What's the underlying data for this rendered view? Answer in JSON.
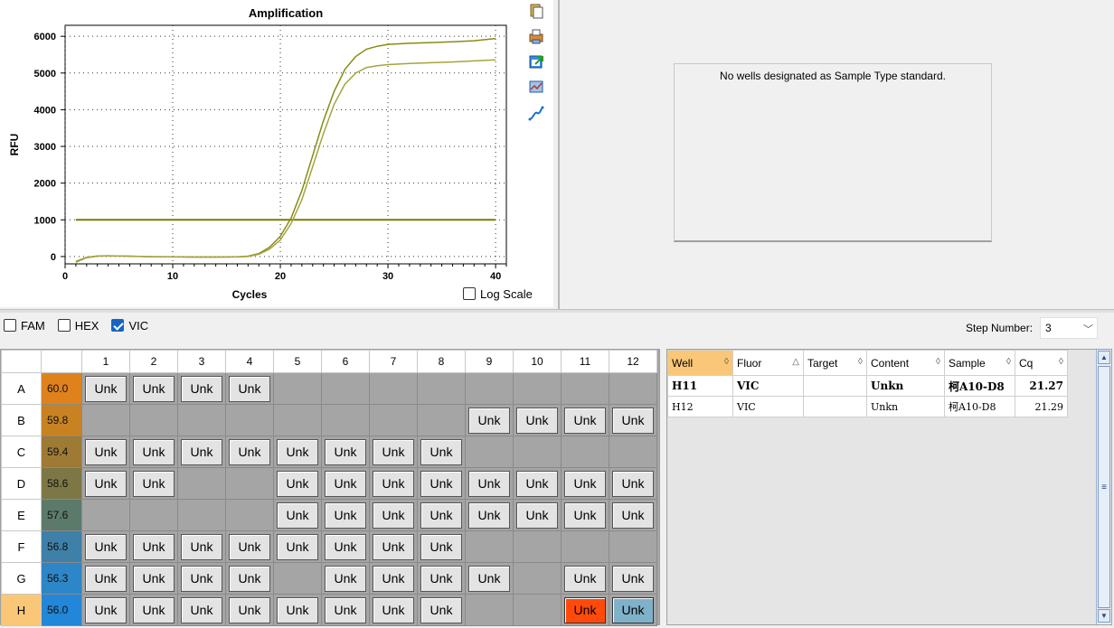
{
  "chart": {
    "title": "Amplification",
    "xlabel": "Cycles",
    "ylabel": "RFU",
    "log_scale_label": "Log Scale",
    "log_scale_checked": false
  },
  "chart_data": {
    "type": "line",
    "title": "Amplification",
    "xlabel": "Cycles",
    "ylabel": "RFU",
    "xlim": [
      0,
      41
    ],
    "ylim": [
      -200,
      6300
    ],
    "x_ticks": [
      0,
      10,
      20,
      30,
      40
    ],
    "y_ticks": [
      0,
      1000,
      2000,
      3000,
      4000,
      5000,
      6000
    ],
    "grid": "dotted",
    "series": [
      {
        "color": "#8a8a14",
        "x": [
          1,
          2,
          3,
          4,
          6,
          8,
          10,
          12,
          14,
          16,
          17,
          18,
          19,
          20,
          21,
          22,
          23,
          24,
          25,
          26,
          27,
          28,
          29,
          30,
          32,
          34,
          36,
          38,
          40
        ],
        "y": [
          -150,
          -30,
          10,
          20,
          10,
          -5,
          -10,
          -15,
          -15,
          -10,
          10,
          80,
          250,
          550,
          1050,
          1800,
          2750,
          3700,
          4500,
          5100,
          5450,
          5650,
          5730,
          5780,
          5810,
          5830,
          5850,
          5880,
          5940
        ]
      },
      {
        "color": "#a4a440",
        "x": [
          1,
          2,
          3,
          4,
          6,
          8,
          10,
          12,
          14,
          16,
          17,
          18,
          19,
          20,
          21,
          22,
          23,
          24,
          25,
          26,
          27,
          28,
          29,
          30,
          32,
          34,
          36,
          38,
          40
        ],
        "y": [
          -130,
          -20,
          15,
          20,
          10,
          -5,
          -10,
          -15,
          -15,
          -10,
          0,
          60,
          200,
          450,
          900,
          1550,
          2450,
          3350,
          4150,
          4700,
          5000,
          5150,
          5200,
          5230,
          5260,
          5280,
          5300,
          5330,
          5360
        ]
      }
    ],
    "threshold": {
      "value": 1000,
      "color": "#7a7a05"
    }
  },
  "standard_curve": {
    "message": "No wells designated as Sample Type standard."
  },
  "fluors": [
    {
      "label": "FAM",
      "checked": false
    },
    {
      "label": "HEX",
      "checked": false
    },
    {
      "label": "VIC",
      "checked": true
    }
  ],
  "step": {
    "label": "Step Number:",
    "value": "3"
  },
  "plate": {
    "columns": [
      "1",
      "2",
      "3",
      "4",
      "5",
      "6",
      "7",
      "8",
      "9",
      "10",
      "11",
      "12"
    ],
    "selected_column": "11",
    "rows": [
      {
        "label": "A",
        "temp": "60.0",
        "temp_color": "#e0821c",
        "wells": [
          "Unk",
          "Unk",
          "Unk",
          "Unk",
          "",
          "",
          "",
          "",
          "",
          "",
          "",
          ""
        ]
      },
      {
        "label": "B",
        "temp": "59.8",
        "temp_color": "#c98222",
        "wells": [
          "",
          "",
          "",
          "",
          "",
          "",
          "",
          "",
          "Unk",
          "Unk",
          "Unk",
          "Unk"
        ]
      },
      {
        "label": "C",
        "temp": "59.4",
        "temp_color": "#9e7a35",
        "wells": [
          "Unk",
          "Unk",
          "Unk",
          "Unk",
          "Unk",
          "Unk",
          "Unk",
          "Unk",
          "",
          "",
          "",
          ""
        ]
      },
      {
        "label": "D",
        "temp": "58.6",
        "temp_color": "#7d7746",
        "wells": [
          "Unk",
          "Unk",
          "",
          "",
          "Unk",
          "Unk",
          "Unk",
          "Unk",
          "Unk",
          "Unk",
          "Unk",
          "Unk"
        ]
      },
      {
        "label": "E",
        "temp": "57.6",
        "temp_color": "#5c7a6a",
        "wells": [
          "",
          "",
          "",
          "",
          "Unk",
          "Unk",
          "Unk",
          "Unk",
          "Unk",
          "Unk",
          "Unk",
          "Unk"
        ]
      },
      {
        "label": "F",
        "temp": "56.8",
        "temp_color": "#3e80a8",
        "wells": [
          "Unk",
          "Unk",
          "Unk",
          "Unk",
          "Unk",
          "Unk",
          "Unk",
          "Unk",
          "",
          "",
          "",
          ""
        ]
      },
      {
        "label": "G",
        "temp": "56.3",
        "temp_color": "#2c86c8",
        "wells": [
          "Unk",
          "Unk",
          "Unk",
          "Unk",
          "",
          "Unk",
          "Unk",
          "Unk",
          "Unk",
          "",
          "Unk",
          "Unk"
        ]
      },
      {
        "label": "H",
        "temp": "56.0",
        "temp_color": "#2287d8",
        "wells": [
          "Unk",
          "Unk",
          "Unk",
          "Unk",
          "Unk",
          "Unk",
          "Unk",
          "Unk",
          "",
          "",
          "Unk",
          "Unk"
        ]
      }
    ],
    "selected_row": "H",
    "highlight_wells": {
      "H11": "red",
      "H12": "teal"
    }
  },
  "results": {
    "headers": [
      "Well",
      "Fluor",
      "Target",
      "Content",
      "Sample",
      "Cq"
    ],
    "header_sort_icons": [
      "◊",
      "△",
      "◊",
      "◊",
      "◊",
      "◊"
    ],
    "rows": [
      {
        "well": "H11",
        "fluor": "VIC",
        "target": "",
        "content": "Unkn",
        "sample": "柯A10-D8",
        "cq": "21.27",
        "bold": true
      },
      {
        "well": "H12",
        "fluor": "VIC",
        "target": "",
        "content": "Unkn",
        "sample": "柯A10-D8",
        "cq": "21.29",
        "bold": false
      }
    ]
  }
}
